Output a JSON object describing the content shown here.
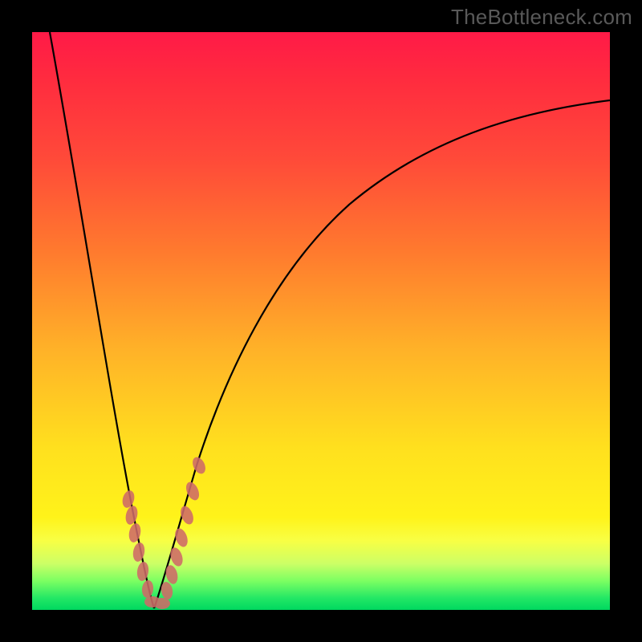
{
  "watermark": "TheBottleneck.com",
  "chart_data": {
    "type": "line",
    "title": "",
    "xlabel": "",
    "ylabel": "",
    "xlim": [
      0,
      100
    ],
    "ylim": [
      0,
      100
    ],
    "note": "Bottleneck curve: minimum near x≈20; left branch falls steeply from top-left to min, right branch rises with diminishing slope toward top-right. Axis numeric values not labeled in source image; x/y are normalized 0–100 estimates read from plotted geometry.",
    "series": [
      {
        "name": "left-branch",
        "x": [
          3,
          6,
          9,
          12,
          15,
          17,
          18.5,
          20
        ],
        "values": [
          100,
          82,
          63,
          44,
          27,
          14,
          6,
          0
        ]
      },
      {
        "name": "right-branch",
        "x": [
          20,
          22,
          25,
          30,
          38,
          48,
          60,
          72,
          84,
          96,
          100
        ],
        "values": [
          0,
          6,
          16,
          33,
          51,
          64,
          74,
          80,
          84,
          87,
          88
        ]
      }
    ],
    "markers": {
      "name": "highlighted-points",
      "color": "#cf6b68",
      "x": [
        16.5,
        16.8,
        17.6,
        18.2,
        18.9,
        19.6,
        20.3,
        21.1,
        21.8,
        22.6,
        23.2,
        24.1,
        25.2,
        26.1
      ],
      "y": [
        18,
        15,
        11,
        8,
        5,
        2,
        1,
        2,
        5,
        8,
        11,
        15,
        21,
        26
      ]
    },
    "background_gradient": {
      "top": "#ff1a47",
      "upper_mid": "#ff7a2e",
      "mid": "#ffe01e",
      "lower": "#ccff66",
      "bottom": "#00d85f"
    }
  }
}
